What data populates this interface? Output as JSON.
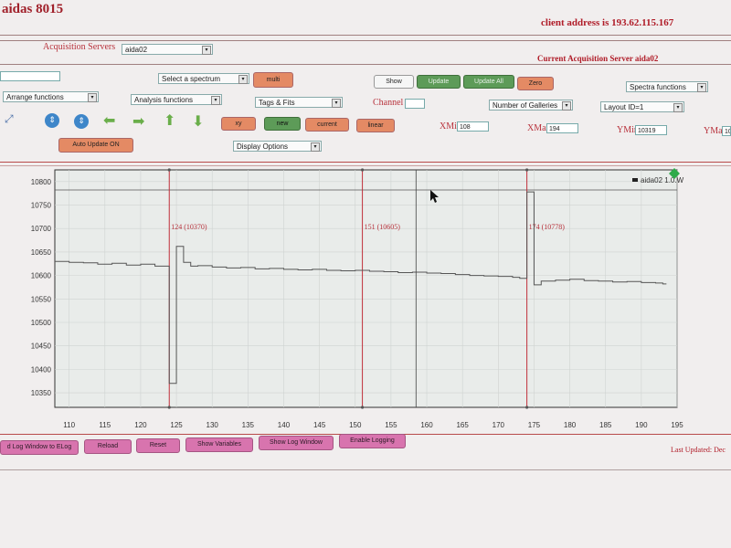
{
  "app_title": "aidas 8015",
  "client_address": "client address is 193.62.115.167",
  "acquisition": {
    "label": "Acquisition Servers",
    "server_value": "aida02",
    "current": "Current Acquisition Server aida02"
  },
  "controls": {
    "select_spectrum": "Select a spectrum",
    "multi": "multi",
    "show": "Show",
    "update": "Update",
    "update_all": "Update All",
    "zero": "Zero",
    "spectra_functions": "Spectra functions",
    "arrange_functions": "Arrange functions",
    "analysis_functions": "Analysis functions",
    "tags_fits": "Tags & Fits",
    "channel_label": "Channel",
    "number_of_galleries": "Number of Galleries",
    "layout_id": "Layout ID=1",
    "xy": "xy",
    "new": "new",
    "current": "current",
    "linear": "linear",
    "xmin_label": "XMin",
    "xmin_value": "108",
    "xmax_label": "XMax",
    "xmax_value": "194",
    "ymin_label": "YMin",
    "ymin_value": "10319",
    "ymax_label": "YMax",
    "ymax_value": "10",
    "auto_update": "Auto Update ON",
    "display_options": "Display Options"
  },
  "bottom_buttons": {
    "log_to_elog": "d Log Window to ELog",
    "reload": "Reload",
    "reset": "Reset",
    "show_variables": "Show Variables",
    "show_log_window": "Show Log Window",
    "enable_logging": "Enable Logging"
  },
  "last_updated": "Last Updated: Dec",
  "colors": {
    "accent_red": "#b01c28",
    "orange": "#e48a64",
    "green": "#5d9b58",
    "pink": "#d874ae"
  },
  "chart_data": {
    "type": "line",
    "legend": "aida02 1.0.W",
    "xlim": [
      108,
      195
    ],
    "ylim": [
      10319,
      10825
    ],
    "xticks": [
      110,
      115,
      120,
      125,
      130,
      135,
      140,
      145,
      150,
      155,
      160,
      165,
      170,
      175,
      180,
      185,
      190,
      195
    ],
    "yticks": [
      10350,
      10400,
      10450,
      10500,
      10550,
      10600,
      10650,
      10700,
      10750,
      10800
    ],
    "series": [
      {
        "x": [
          108,
          110,
          112,
          114,
          116,
          118,
          120,
          122,
          124,
          125,
          126,
          127,
          128,
          130,
          132,
          134,
          136,
          138,
          140,
          142,
          144,
          146,
          148,
          150,
          152,
          154,
          156,
          158,
          160,
          162,
          164,
          166,
          168,
          170,
          172,
          173,
          174,
          175,
          176,
          178,
          180,
          182,
          184,
          186,
          188,
          190,
          192,
          193
        ],
        "y": [
          10630,
          10628,
          10627,
          10624,
          10626,
          10622,
          10624,
          10620,
          10370,
          10662,
          10628,
          10620,
          10621,
          10618,
          10616,
          10617,
          10614,
          10615,
          10613,
          10612,
          10613,
          10611,
          10610,
          10611,
          10609,
          10608,
          10606,
          10607,
          10605,
          10604,
          10602,
          10600,
          10599,
          10598,
          10596,
          10594,
          10778,
          10580,
          10588,
          10590,
          10592,
          10589,
          10588,
          10586,
          10587,
          10585,
          10584,
          10582
        ]
      }
    ],
    "markers": [
      {
        "x": 124,
        "label": "124 (10370)"
      },
      {
        "x": 151,
        "label": "151 (10605)"
      },
      {
        "x": 174,
        "label": "174 (10778)"
      }
    ],
    "cursor_x": 158.5
  }
}
